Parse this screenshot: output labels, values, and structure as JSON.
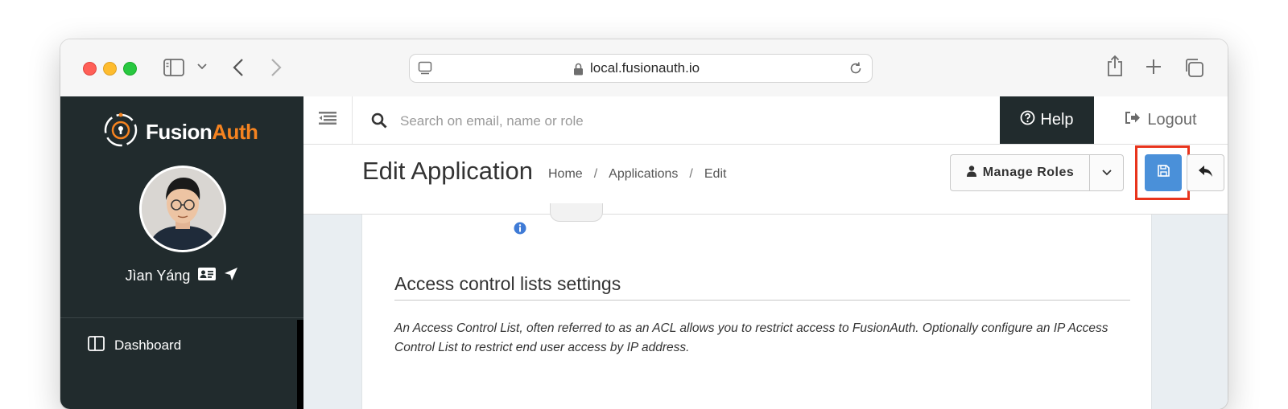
{
  "browser": {
    "url": "local.fusionauth.io"
  },
  "brand": {
    "name_part1": "Fusion",
    "name_part2": "Auth",
    "accent": "#f58320",
    "sidebar_bg": "#212b2d"
  },
  "sidebar": {
    "user_name": "Jìan Yáng",
    "items": [
      {
        "label": "Dashboard",
        "icon": "dashboard-icon"
      }
    ]
  },
  "topbar": {
    "search_placeholder": "Search on email, name or role",
    "help_label": "Help",
    "logout_label": "Logout"
  },
  "page": {
    "title": "Edit Application",
    "breadcrumb": [
      "Home",
      "Applications",
      "Edit"
    ],
    "breadcrumb_sep": "/",
    "manage_roles_label": "Manage Roles",
    "save_button_color": "#4a90d9",
    "highlight_color": "#e8341c"
  },
  "section": {
    "title": "Access control lists settings",
    "description": "An Access Control List, often referred to as an ACL allows you to restrict access to FusionAuth. Optionally configure an IP Access Control List to restrict end user access by IP address."
  }
}
